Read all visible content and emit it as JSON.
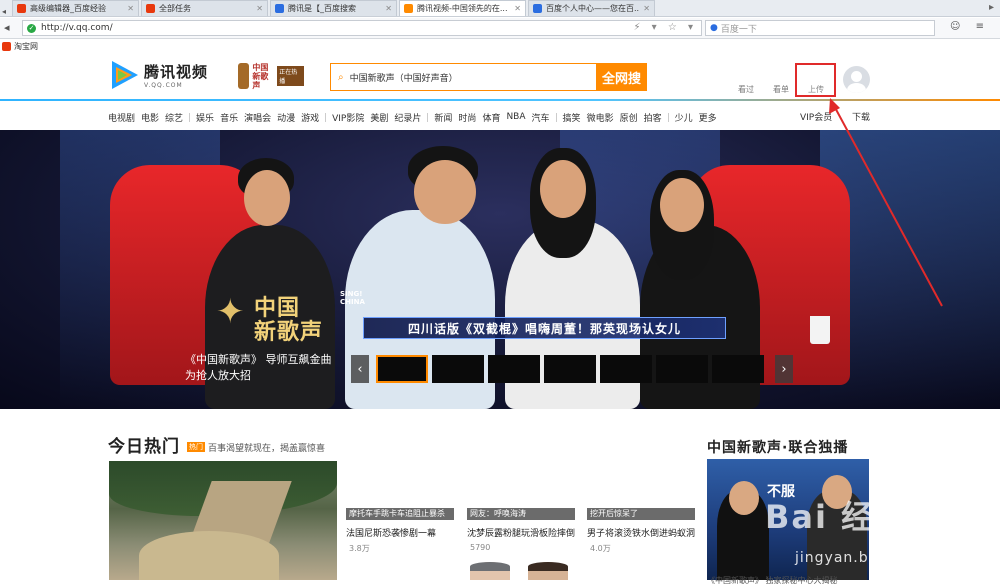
{
  "browser": {
    "tabs": [
      {
        "label": "高级编辑器_百度经验",
        "icon_color": "#e8380d"
      },
      {
        "label": "全部任务",
        "icon_color": "#e8380d"
      },
      {
        "label": "腾讯是【_百度搜索",
        "icon_color": "#2b6de0"
      },
      {
        "label": "腾讯视频-中国领先的在...",
        "icon_color": "#ff8a00"
      },
      {
        "label": "百度个人中心——您在百...",
        "icon_color": "#2b6de0"
      }
    ],
    "url": "http://v.qq.com/",
    "search_placeholder": "百度一下",
    "bookmark": "淘宝网"
  },
  "site": {
    "logo_title": "腾讯视频",
    "logo_sub": "V.QQ.COM",
    "promo_line1": "中国",
    "promo_line2": "新歌声",
    "promo_tag": "正在热播",
    "search_value": "中国新歌声（中国好声音）",
    "search_button": "全网搜",
    "links": {
      "history": "看过",
      "playlist": "看单",
      "upload": "上传"
    },
    "channels_group1": [
      "电视剧",
      "电影",
      "综艺"
    ],
    "channels_group2": [
      "娱乐",
      "音乐",
      "演唱会",
      "动漫",
      "游戏"
    ],
    "channels_group3": [
      "VIP影院",
      "美剧",
      "纪录片"
    ],
    "channels_group4": [
      "新闻",
      "时尚",
      "体育",
      "NBA",
      "汽车"
    ],
    "channels_group5": [
      "搞笑",
      "微电影",
      "原创",
      "拍客"
    ],
    "channels_group6": [
      "少儿",
      "更多"
    ],
    "vip": "VIP会员",
    "download": "下载"
  },
  "hero": {
    "logo_main1": "中国",
    "logo_main2": "新歌声",
    "logo_sing": "SING!",
    "logo_china": "CHINA",
    "caption": "四川话版《双截棍》唱嗨周董！那英现场认女儿",
    "title_line1": "《中国新歌声》 导师互飙金曲",
    "title_line2": "为抢人放大招",
    "prev": "‹",
    "next": "›"
  },
  "today": {
    "title": "今日热门",
    "badge": "热门",
    "promo": "百事渴望就现在，揭盖赢惊喜",
    "cards": [
      {
        "tag": "摩托车手跳卡车追阻止暴杀",
        "title": "法国尼斯恐袭惨剧一幕",
        "count": "3.8万"
      },
      {
        "tag": "网友：呼唤海涛",
        "title": "沈梦辰露粉腿玩滑板险摔倒",
        "count": "5790"
      },
      {
        "tag": "挖开后惊呆了",
        "title": "男子将滚烫铁水倒进蚂蚁洞",
        "count": "4.0万"
      }
    ]
  },
  "sidebar": {
    "title": "中国新歌声·联合独播",
    "thumb_word": "不服",
    "caption": "《中国新歌声》 独家探秘中心大揭秘"
  },
  "watermark": {
    "main": "Bai 经验",
    "sub": "jingyan.baidu.com"
  }
}
